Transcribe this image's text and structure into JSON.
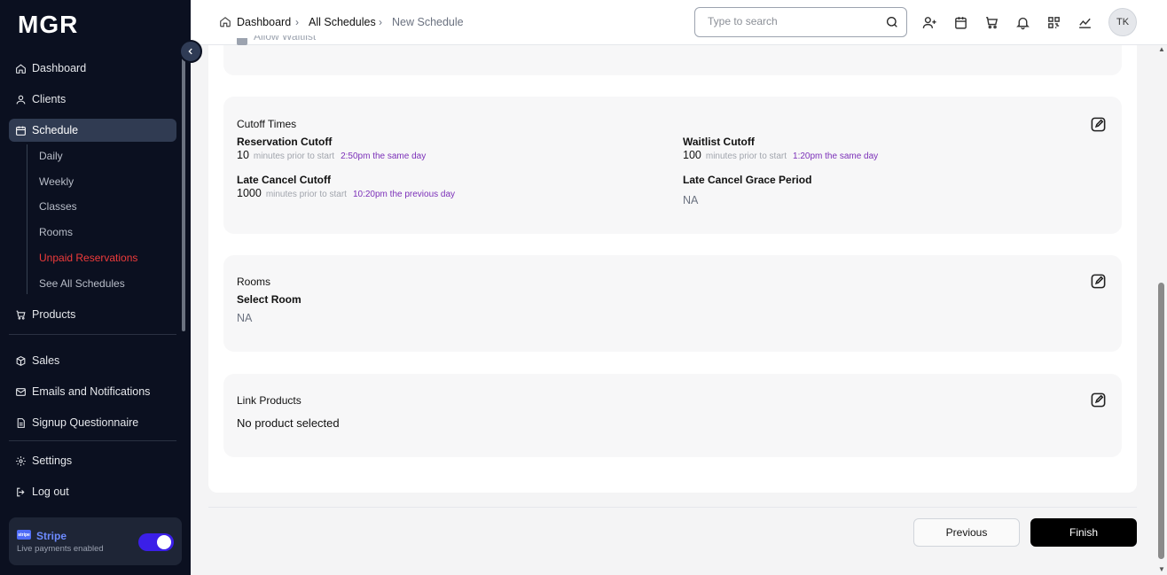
{
  "app": {
    "logo": "MGR"
  },
  "sidebar": {
    "items": [
      {
        "label": "Dashboard"
      },
      {
        "label": "Clients"
      },
      {
        "label": "Schedule"
      },
      {
        "label": "Products"
      },
      {
        "label": "Sales"
      },
      {
        "label": "Emails and Notifications"
      },
      {
        "label": "Signup Questionnaire"
      },
      {
        "label": "Settings"
      },
      {
        "label": "Log out"
      }
    ],
    "schedule_sub": [
      {
        "label": "Daily"
      },
      {
        "label": "Weekly"
      },
      {
        "label": "Classes"
      },
      {
        "label": "Rooms"
      },
      {
        "label": "Unpaid Reservations"
      },
      {
        "label": "See All Schedules"
      }
    ],
    "stripe": {
      "logo_text": "stripe",
      "title": "Stripe",
      "subtitle": "Live payments enabled",
      "enabled": true
    }
  },
  "header": {
    "breadcrumb": [
      "Dashboard",
      "All Schedules",
      "New Schedule"
    ],
    "search_placeholder": "Type to search",
    "avatar_initials": "TK"
  },
  "partial": {
    "label": "Allow Waitlist"
  },
  "cutoff": {
    "title": "Cutoff Times",
    "reservation": {
      "label": "Reservation Cutoff",
      "value": "10",
      "unit": "minutes prior to start",
      "time": "2:50pm the same day"
    },
    "waitlist": {
      "label": "Waitlist Cutoff",
      "value": "100",
      "unit": "minutes prior to start",
      "time": "1:20pm the same day"
    },
    "late_cancel": {
      "label": "Late Cancel Cutoff",
      "value": "1000",
      "unit": "minutes prior to start",
      "time": "10:20pm the previous day"
    },
    "grace": {
      "label": "Late Cancel Grace Period",
      "value": "NA"
    }
  },
  "rooms": {
    "title": "Rooms",
    "label": "Select Room",
    "value": "NA"
  },
  "link_products": {
    "title": "Link Products",
    "value": "No product selected"
  },
  "footer": {
    "previous": "Previous",
    "finish": "Finish"
  }
}
